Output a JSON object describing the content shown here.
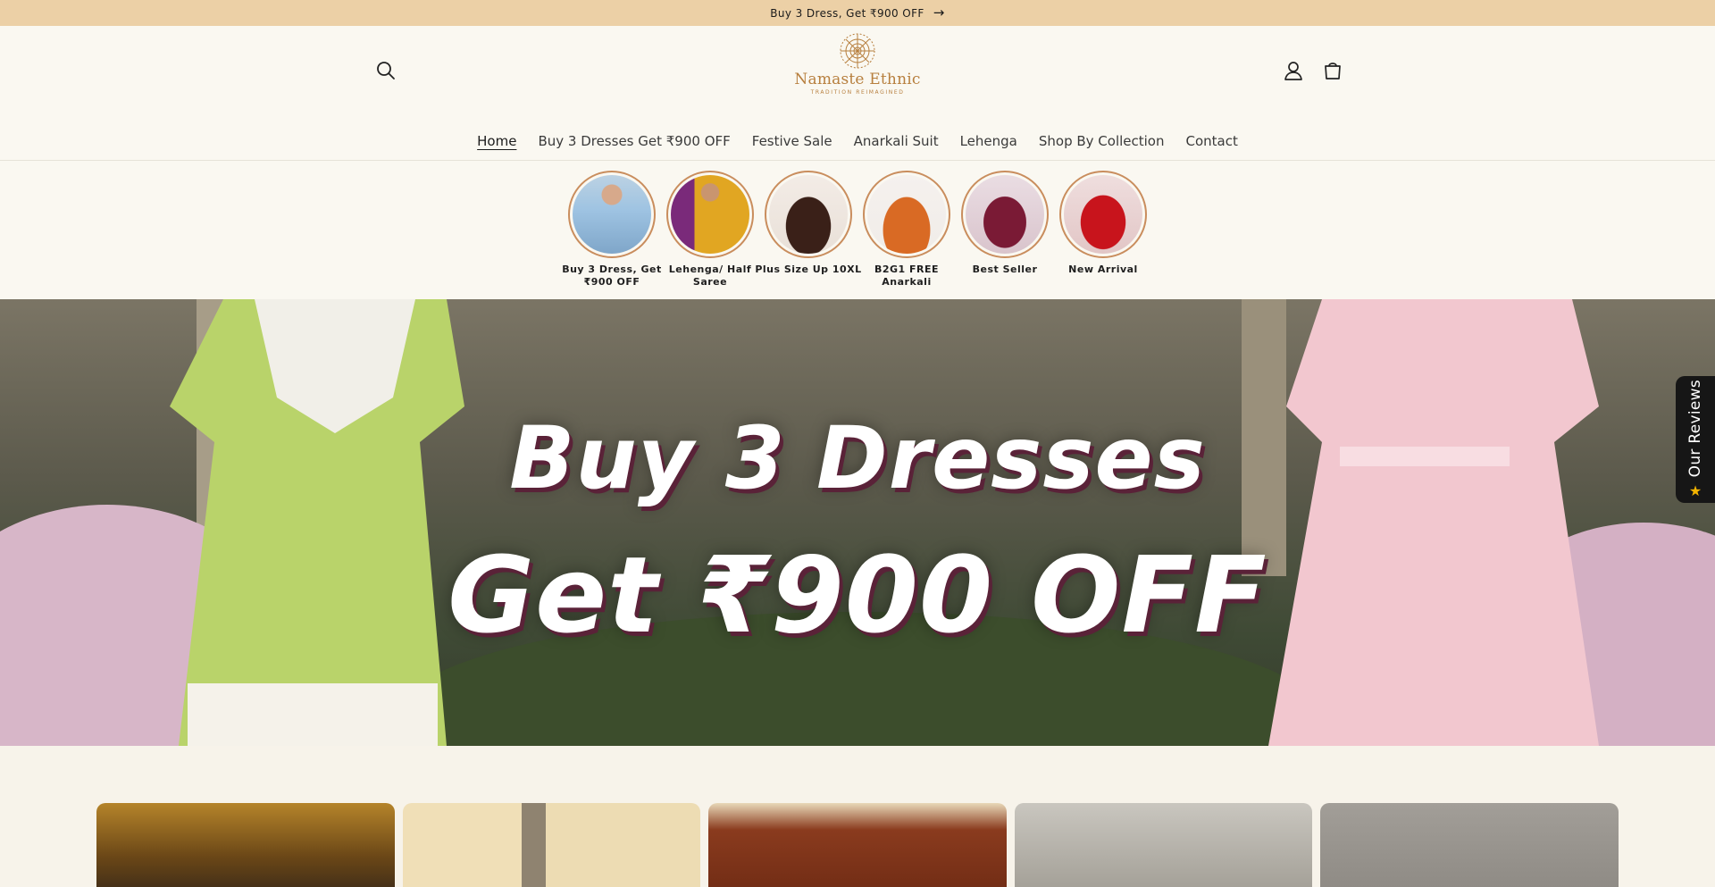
{
  "announcement": {
    "text": "Buy 3 Dress, Get ₹900 OFF",
    "arrow": "→"
  },
  "header": {
    "logo": {
      "name": "Namaste Ethnic",
      "tagline": "TRADITION REIMAGINED"
    },
    "icons": [
      "search-icon",
      "account-icon",
      "cart-icon"
    ]
  },
  "nav": {
    "items": [
      {
        "label": "Home",
        "active": true
      },
      {
        "label": "Buy 3 Dresses Get ₹900 OFF",
        "active": false
      },
      {
        "label": "Festive Sale",
        "active": false
      },
      {
        "label": "Anarkali Suit",
        "active": false
      },
      {
        "label": "Lehenga",
        "active": false
      },
      {
        "label": "Shop By Collection",
        "active": false
      },
      {
        "label": "Contact",
        "active": false
      }
    ]
  },
  "categories": [
    {
      "label": "Buy 3 Dress, Get ₹900 OFF",
      "colors": [
        "#9ec3e2",
        "#d7a98b"
      ]
    },
    {
      "label": "Lehenga/ Half Saree",
      "colors": [
        "#e1a622",
        "#7a2a7a"
      ]
    },
    {
      "label": "Plus Size Up 10XL",
      "colors": [
        "#3a2018",
        "#e9e0d8"
      ]
    },
    {
      "label": "B2G1 FREE Anarkali",
      "colors": [
        "#d96a24",
        "#f0ece8"
      ]
    },
    {
      "label": "Best Seller",
      "colors": [
        "#7a1a35",
        "#e8d8e0"
      ]
    },
    {
      "label": "New Arrival",
      "colors": [
        "#c8141c",
        "#e9d4d4"
      ]
    }
  ],
  "hero": {
    "line1": "Buy 3 Dresses",
    "line2": "Get ₹900 OFF"
  },
  "reviews_tab": {
    "label": "Our Reviews",
    "star": "★"
  },
  "colors": {
    "announcement_bg": "#ecd0a6",
    "page_bg": "#f7f3ea",
    "logo_gold": "#b77f3e",
    "category_ring": "#c98d5d",
    "hero_text_shadow": "#5a2238"
  }
}
